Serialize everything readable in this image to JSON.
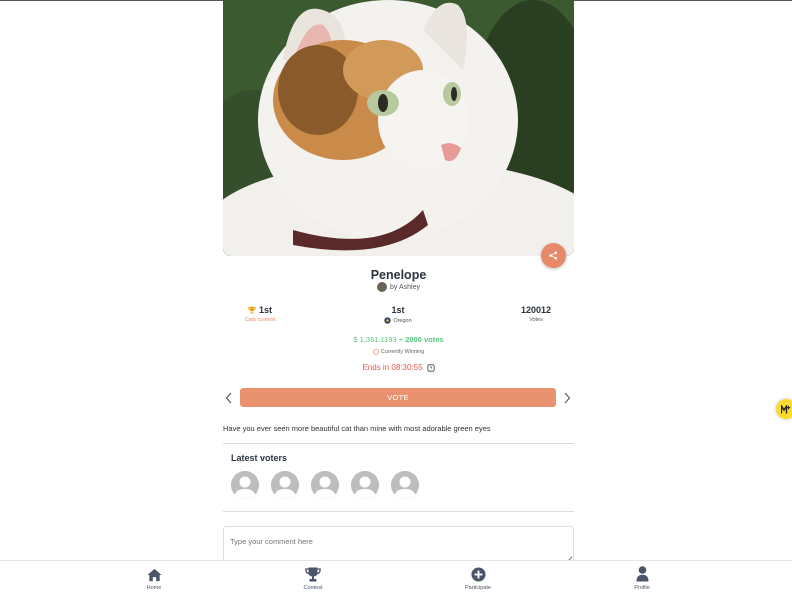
{
  "pet": {
    "name": "Penelope",
    "byline": "by Ashley"
  },
  "stats": {
    "rank_cats": "1st",
    "rank_cats_label": "Cats contest",
    "rank_state": "1st",
    "state_label": "Oregon",
    "votes_count": "120012",
    "votes_label": "Votes"
  },
  "prize": {
    "amount": "$ 1,351.1193",
    "plus": " + ",
    "votes": "2000 votes",
    "status": "Currently Winning",
    "ends": "Ends in 08:30:55"
  },
  "vote_button": "VOTE",
  "description": "Have you ever seen more beautiful cat than mine with most adorable green eyes",
  "voters": {
    "title": "Latest voters",
    "count": 5
  },
  "comment": {
    "placeholder": "Type your comment here"
  },
  "nav": {
    "home": "Home",
    "contest": "Contest",
    "participate": "Participate",
    "profile": "Profile"
  },
  "colors": {
    "accent": "#e8896a",
    "prize_green": "#58c77b",
    "ends_red": "#e05a4a",
    "nav_icon": "#4a5668"
  },
  "icons": [
    "share-icon",
    "trophy-icon",
    "state-flag-icon",
    "clock-icon",
    "chevron-left-icon",
    "chevron-right-icon",
    "avatar-placeholder-icon",
    "home-icon",
    "trophy-icon",
    "plus-circle-icon",
    "user-icon",
    "assistant-badge-icon"
  ]
}
